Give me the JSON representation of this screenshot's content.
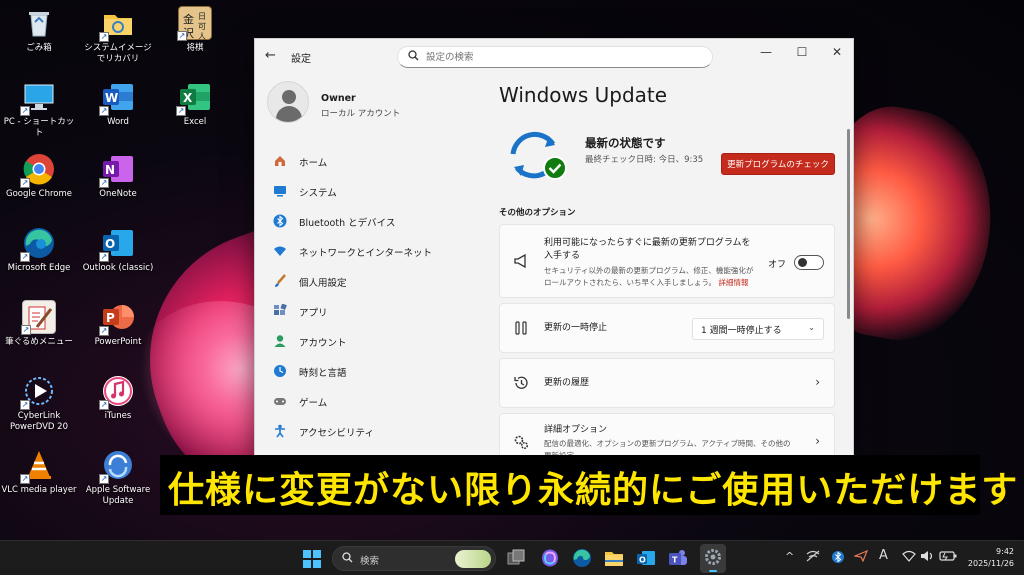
{
  "desktop": {
    "icons": [
      {
        "label": "ごみ箱",
        "icon": "recycle-bin-icon"
      },
      {
        "label": "システムイメージでリカバリ",
        "icon": "folder-recovery-icon"
      },
      {
        "label": "将棋",
        "icon": "shogi-icon"
      },
      {
        "label": "PC - ショートカット",
        "icon": "pc-icon"
      },
      {
        "label": "Word",
        "icon": "word-icon"
      },
      {
        "label": "Excel",
        "icon": "excel-icon"
      },
      {
        "label": "Google Chrome",
        "icon": "chrome-icon"
      },
      {
        "label": "OneNote",
        "icon": "onenote-icon"
      },
      {
        "label": "Microsoft Edge",
        "icon": "edge-icon"
      },
      {
        "label": "Outlook (classic)",
        "icon": "outlook-icon"
      },
      {
        "label": "筆ぐるめメニュー",
        "icon": "fudegurume-icon"
      },
      {
        "label": "PowerPoint",
        "icon": "powerpoint-icon"
      },
      {
        "label": "CyberLink PowerDVD 20",
        "icon": "powerdvd-icon"
      },
      {
        "label": "iTunes",
        "icon": "itunes-icon"
      },
      {
        "label": "VLC media player",
        "icon": "vlc-icon"
      },
      {
        "label": "Apple Software Update",
        "icon": "apple-update-icon"
      }
    ],
    "shogi_icon_chars": "金沢 日 可 人"
  },
  "settings": {
    "app_title": "設定",
    "search_placeholder": "設定の検索",
    "user": {
      "name": "Owner",
      "account": "ローカル アカウント"
    },
    "nav": [
      {
        "label": "ホーム",
        "icon": "home-icon",
        "color": "#d06a3c"
      },
      {
        "label": "システム",
        "icon": "system-icon",
        "color": "#1f7ad1"
      },
      {
        "label": "Bluetooth とデバイス",
        "icon": "bluetooth-icon",
        "color": "#1f7ad1"
      },
      {
        "label": "ネットワークとインターネット",
        "icon": "wifi-icon",
        "color": "#1f7ad1"
      },
      {
        "label": "個人用設定",
        "icon": "brush-icon",
        "color": "#c47a2c"
      },
      {
        "label": "アプリ",
        "icon": "apps-icon",
        "color": "#4a6fa5"
      },
      {
        "label": "アカウント",
        "icon": "account-icon",
        "color": "#2b9a5e"
      },
      {
        "label": "時刻と言語",
        "icon": "clock-globe-icon",
        "color": "#1f7ad1"
      },
      {
        "label": "ゲーム",
        "icon": "gamepad-icon",
        "color": "#666666"
      },
      {
        "label": "アクセシビリティ",
        "icon": "accessibility-icon",
        "color": "#1f7ad1"
      }
    ],
    "page_title": "Windows Update",
    "status": {
      "title": "最新の状態です",
      "last_check": "最終チェック日時: 今日、9:35",
      "check_button": "更新プログラムのチェック"
    },
    "other_options_heading": "その他のオプション",
    "cards": {
      "latest_updates": {
        "title": "利用可能になったらすぐに最新の更新プログラムを入手する",
        "desc": "セキュリティ以外の最新の更新プログラム、修正、機能強化がロールアウトされたら、いち早く入手しましょう。",
        "link": "詳細情報",
        "toggle_label": "オフ",
        "toggle_on": false
      },
      "pause": {
        "title": "更新の一時停止",
        "dropdown_value": "1 週間一時停止する"
      },
      "history": {
        "title": "更新の履歴"
      },
      "advanced": {
        "title": "詳細オプション",
        "desc": "配信の最適化、オプションの更新プログラム、アクティブ時間、その他の更新設定"
      }
    }
  },
  "caption": "仕様に変更がない限り永続的にご使用いただけます",
  "taskbar": {
    "search_label": "検索",
    "time": "9:42",
    "date": "2025/11/26",
    "ime_indicator": "A"
  },
  "colors": {
    "accent_red": "#c42b1c",
    "windows_blue": "#4cc2ff",
    "caption_yellow": "#ffe600"
  }
}
